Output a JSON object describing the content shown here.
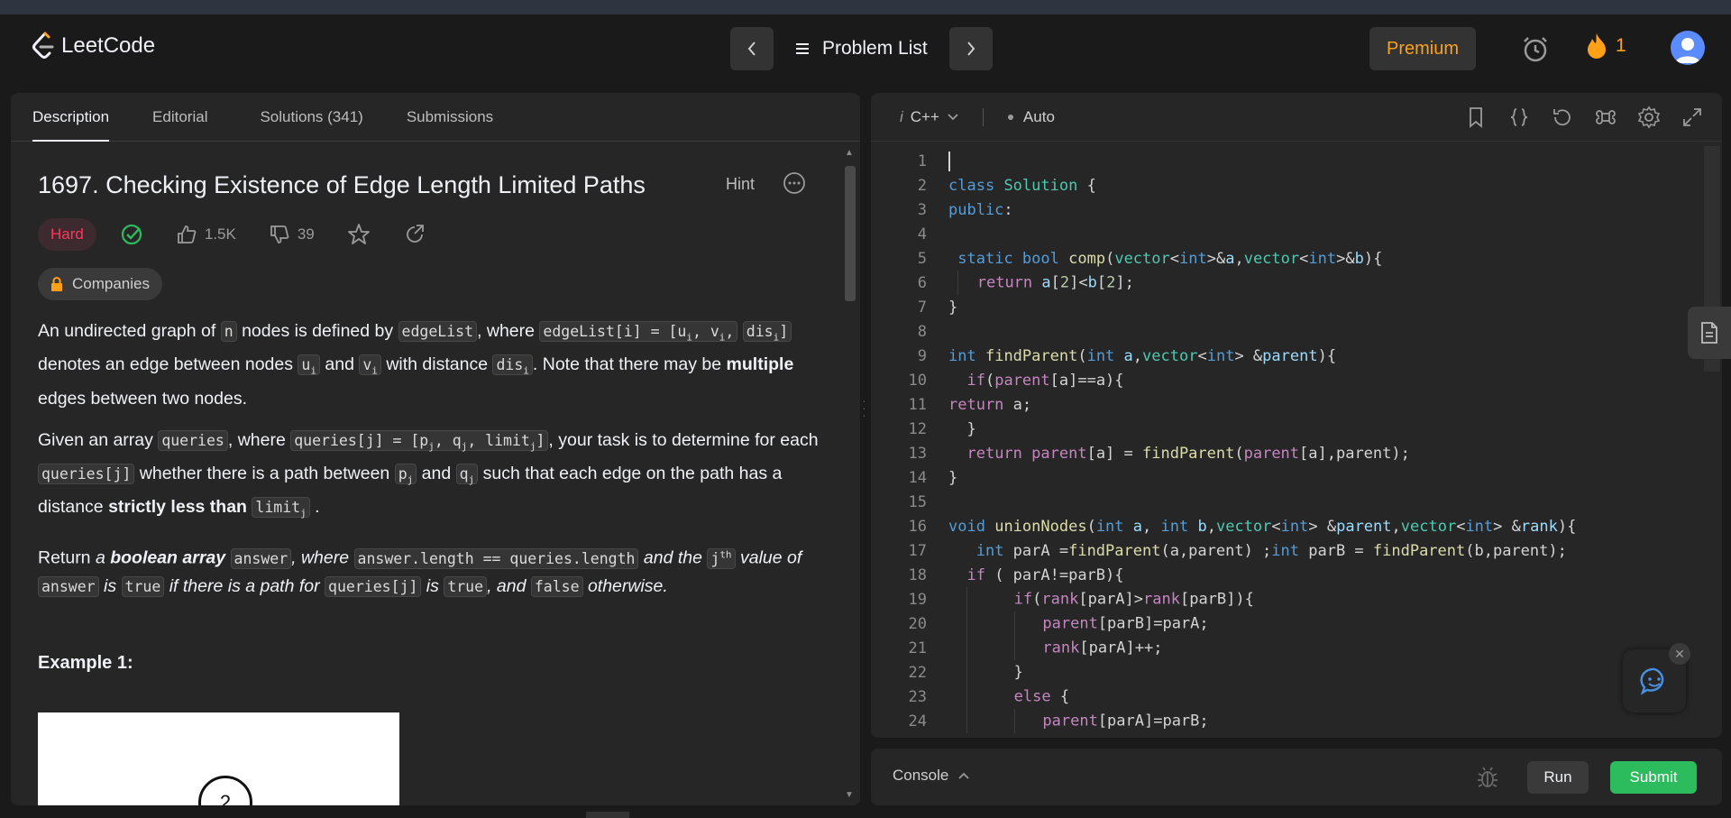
{
  "header": {
    "logo_text": "LeetCode",
    "problem_list_label": "Problem List",
    "premium_label": "Premium",
    "streak_count": "1",
    "accent_color": "#ffa116"
  },
  "left_panel": {
    "tabs": [
      {
        "label": "Description",
        "active": true
      },
      {
        "label": "Editorial",
        "active": false
      },
      {
        "label": "Solutions (341)",
        "active": false
      },
      {
        "label": "Submissions",
        "active": false
      }
    ],
    "title": "1697. Checking Existence of Edge Length Limited Paths",
    "hint_label": "Hint",
    "difficulty": "Hard",
    "difficulty_color": "#ff375f",
    "likes": "1.5K",
    "dislikes": "39",
    "companies_label": "Companies",
    "example_heading": "Example 1:",
    "example_node_label": "2"
  },
  "description": {
    "p1": {
      "t1": "An undirected graph of ",
      "c1": "n",
      "t2": " nodes is defined by ",
      "c2": "edgeList",
      "t3": ", where ",
      "c3a": "edgeList[i] = [u",
      "c3b": "i",
      "c3c": ", v",
      "c3d": "i",
      "c3e": ",",
      "c3f": "dis",
      "c3g": "i",
      "c3h": "]",
      "t4": " denotes an edge between nodes ",
      "c4a": "u",
      "c4b": "i",
      "t5": " and ",
      "c5a": "v",
      "c5b": "i",
      "t6": " with distance ",
      "c6a": "dis",
      "c6b": "i",
      "t7": ". Note that there may be ",
      "b1": "multiple",
      "t8": " edges between two nodes."
    },
    "p2": {
      "t1": "Given an array ",
      "c1": "queries",
      "t2": ", where ",
      "c2a": "queries[j] = [p",
      "c2b": "j",
      "c2c": ", q",
      "c2d": "j",
      "c2e": ", limit",
      "c2f": "j",
      "c2g": "]",
      "t3": ", your task is to determine for each ",
      "c3": "queries[j]",
      "t4": " whether there is a path between ",
      "c4a": "p",
      "c4b": "j",
      "t5": " and ",
      "c5a": "q",
      "c5b": "j",
      "t6": " such that each edge on the path has a distance ",
      "b1": "strictly less than",
      "t7": " ",
      "c7a": "limit",
      "c7b": "j",
      "t8": " ."
    },
    "p3": {
      "t1": "Return ",
      "e1": "a ",
      "b1": "boolean array",
      "t2": " ",
      "c1": "answer",
      "e2": ", where ",
      "c2": "answer.length == queries.length",
      "e3": " and the ",
      "c3a": "j",
      "c3b": "th",
      "e4": " value of ",
      "c4": "answer",
      "e5": " is ",
      "c5": "true",
      "e6": " if there is a path for ",
      "c6": "queries[j]",
      "e7": " is ",
      "c7": "true",
      "e8": ", and ",
      "c8": "false",
      "e9": " otherwise."
    }
  },
  "editor": {
    "language": "C++",
    "language_prefix": "i",
    "mode": "Auto",
    "line_numbers": [
      "1",
      "2",
      "3",
      "4",
      "5",
      "6",
      "7",
      "8",
      "9",
      "10",
      "11",
      "12",
      "13",
      "14",
      "15",
      "16",
      "17",
      "18",
      "19",
      "20",
      "21",
      "22",
      "23",
      "24"
    ]
  },
  "console": {
    "label": "Console",
    "run_label": "Run",
    "submit_label": "Submit",
    "submit_color": "#2cbb5d"
  }
}
